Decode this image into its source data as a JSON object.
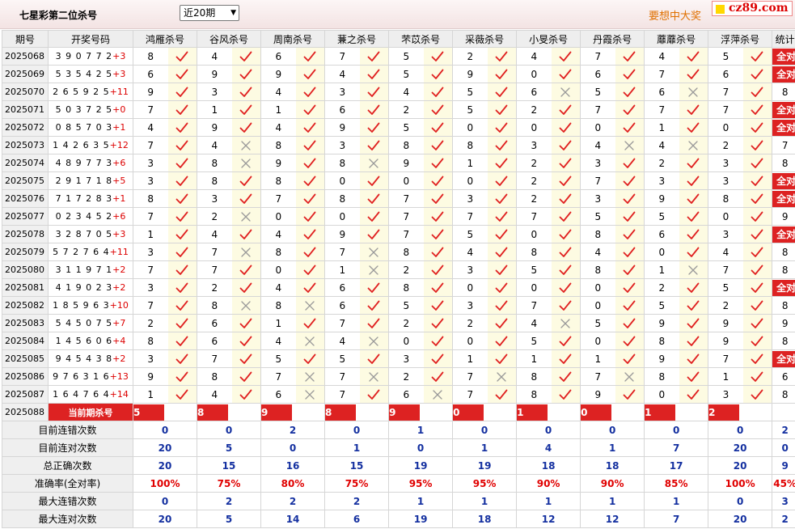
{
  "header": {
    "title": "七星彩第二位杀号",
    "period_select": "近20期",
    "ad_text": "要想中大奖",
    "logo_text": "cz89.com"
  },
  "columns": [
    "期号",
    "开奖号码",
    "鸿雁杀号",
    "谷风杀号",
    "周南杀号",
    "蒹之杀号",
    "芣苡杀号",
    "采薇杀号",
    "小旻杀号",
    "丹霞杀号",
    "蘼蘼杀号",
    "浮萍杀号",
    "统计"
  ],
  "rows": [
    {
      "issue": "2025068",
      "num": "390772",
      "sum": "+3",
      "k": [
        [
          "8",
          1
        ],
        [
          "4",
          1
        ],
        [
          "6",
          1
        ],
        [
          "7",
          1
        ],
        [
          "5",
          1
        ],
        [
          "2",
          1
        ],
        [
          "4",
          1
        ],
        [
          "7",
          1
        ],
        [
          "4",
          1
        ],
        [
          "5",
          1
        ]
      ],
      "stat": "全对"
    },
    {
      "issue": "2025069",
      "num": "535425",
      "sum": "+3",
      "k": [
        [
          "6",
          1
        ],
        [
          "9",
          1
        ],
        [
          "9",
          1
        ],
        [
          "4",
          1
        ],
        [
          "5",
          1
        ],
        [
          "9",
          1
        ],
        [
          "0",
          1
        ],
        [
          "6",
          1
        ],
        [
          "7",
          1
        ],
        [
          "6",
          1
        ]
      ],
      "stat": "全对"
    },
    {
      "issue": "2025070",
      "num": "265925",
      "sum": "+11",
      "k": [
        [
          "9",
          1
        ],
        [
          "3",
          1
        ],
        [
          "4",
          1
        ],
        [
          "3",
          1
        ],
        [
          "4",
          1
        ],
        [
          "5",
          1
        ],
        [
          "6",
          0
        ],
        [
          "5",
          1
        ],
        [
          "6",
          0
        ],
        [
          "7",
          1
        ]
      ],
      "stat": "8"
    },
    {
      "issue": "2025071",
      "num": "503725",
      "sum": "+0",
      "k": [
        [
          "7",
          1
        ],
        [
          "1",
          1
        ],
        [
          "1",
          1
        ],
        [
          "6",
          1
        ],
        [
          "2",
          1
        ],
        [
          "5",
          1
        ],
        [
          "2",
          1
        ],
        [
          "7",
          1
        ],
        [
          "7",
          1
        ],
        [
          "7",
          1
        ]
      ],
      "stat": "全对"
    },
    {
      "issue": "2025072",
      "num": "085703",
      "sum": "+1",
      "k": [
        [
          "4",
          1
        ],
        [
          "9",
          1
        ],
        [
          "4",
          1
        ],
        [
          "9",
          1
        ],
        [
          "5",
          1
        ],
        [
          "0",
          1
        ],
        [
          "0",
          1
        ],
        [
          "0",
          1
        ],
        [
          "1",
          1
        ],
        [
          "0",
          1
        ]
      ],
      "stat": "全对"
    },
    {
      "issue": "2025073",
      "num": "142635",
      "sum": "+12",
      "k": [
        [
          "7",
          1
        ],
        [
          "4",
          0
        ],
        [
          "8",
          1
        ],
        [
          "3",
          1
        ],
        [
          "8",
          1
        ],
        [
          "8",
          1
        ],
        [
          "3",
          1
        ],
        [
          "4",
          0
        ],
        [
          "4",
          0
        ],
        [
          "2",
          1
        ]
      ],
      "stat": "7"
    },
    {
      "issue": "2025074",
      "num": "489773",
      "sum": "+6",
      "k": [
        [
          "3",
          1
        ],
        [
          "8",
          0
        ],
        [
          "9",
          1
        ],
        [
          "8",
          0
        ],
        [
          "9",
          1
        ],
        [
          "1",
          1
        ],
        [
          "2",
          1
        ],
        [
          "3",
          1
        ],
        [
          "2",
          1
        ],
        [
          "3",
          1
        ]
      ],
      "stat": "8"
    },
    {
      "issue": "2025075",
      "num": "291718",
      "sum": "+5",
      "k": [
        [
          "3",
          1
        ],
        [
          "8",
          1
        ],
        [
          "8",
          1
        ],
        [
          "0",
          1
        ],
        [
          "0",
          1
        ],
        [
          "0",
          1
        ],
        [
          "2",
          1
        ],
        [
          "7",
          1
        ],
        [
          "3",
          1
        ],
        [
          "3",
          1
        ]
      ],
      "stat": "全对"
    },
    {
      "issue": "2025076",
      "num": "717283",
      "sum": "+1",
      "k": [
        [
          "8",
          1
        ],
        [
          "3",
          1
        ],
        [
          "7",
          1
        ],
        [
          "8",
          1
        ],
        [
          "7",
          1
        ],
        [
          "3",
          1
        ],
        [
          "2",
          1
        ],
        [
          "3",
          1
        ],
        [
          "9",
          1
        ],
        [
          "8",
          1
        ]
      ],
      "stat": "全对"
    },
    {
      "issue": "2025077",
      "num": "023452",
      "sum": "+6",
      "k": [
        [
          "7",
          1
        ],
        [
          "2",
          0
        ],
        [
          "0",
          1
        ],
        [
          "0",
          1
        ],
        [
          "7",
          1
        ],
        [
          "7",
          1
        ],
        [
          "7",
          1
        ],
        [
          "5",
          1
        ],
        [
          "5",
          1
        ],
        [
          "0",
          1
        ]
      ],
      "stat": "9"
    },
    {
      "issue": "2025078",
      "num": "328705",
      "sum": "+3",
      "k": [
        [
          "1",
          1
        ],
        [
          "4",
          1
        ],
        [
          "4",
          1
        ],
        [
          "9",
          1
        ],
        [
          "7",
          1
        ],
        [
          "5",
          1
        ],
        [
          "0",
          1
        ],
        [
          "8",
          1
        ],
        [
          "6",
          1
        ],
        [
          "3",
          1
        ]
      ],
      "stat": "全对"
    },
    {
      "issue": "2025079",
      "num": "572764",
      "sum": "+11",
      "k": [
        [
          "3",
          1
        ],
        [
          "7",
          0
        ],
        [
          "8",
          1
        ],
        [
          "7",
          0
        ],
        [
          "8",
          1
        ],
        [
          "4",
          1
        ],
        [
          "8",
          1
        ],
        [
          "4",
          1
        ],
        [
          "0",
          1
        ],
        [
          "4",
          1
        ]
      ],
      "stat": "8"
    },
    {
      "issue": "2025080",
      "num": "311971",
      "sum": "+2",
      "k": [
        [
          "7",
          1
        ],
        [
          "7",
          1
        ],
        [
          "0",
          1
        ],
        [
          "1",
          0
        ],
        [
          "2",
          1
        ],
        [
          "3",
          1
        ],
        [
          "5",
          1
        ],
        [
          "8",
          1
        ],
        [
          "1",
          0
        ],
        [
          "7",
          1
        ]
      ],
      "stat": "8"
    },
    {
      "issue": "2025081",
      "num": "419023",
      "sum": "+2",
      "k": [
        [
          "3",
          1
        ],
        [
          "2",
          1
        ],
        [
          "4",
          1
        ],
        [
          "6",
          1
        ],
        [
          "8",
          1
        ],
        [
          "0",
          1
        ],
        [
          "0",
          1
        ],
        [
          "0",
          1
        ],
        [
          "2",
          1
        ],
        [
          "5",
          1
        ]
      ],
      "stat": "全对"
    },
    {
      "issue": "2025082",
      "num": "185963",
      "sum": "+10",
      "k": [
        [
          "7",
          1
        ],
        [
          "8",
          0
        ],
        [
          "8",
          0
        ],
        [
          "6",
          1
        ],
        [
          "5",
          1
        ],
        [
          "3",
          1
        ],
        [
          "7",
          1
        ],
        [
          "0",
          1
        ],
        [
          "5",
          1
        ],
        [
          "2",
          1
        ]
      ],
      "stat": "8"
    },
    {
      "issue": "2025083",
      "num": "545075",
      "sum": "+7",
      "k": [
        [
          "2",
          1
        ],
        [
          "6",
          1
        ],
        [
          "1",
          1
        ],
        [
          "7",
          1
        ],
        [
          "2",
          1
        ],
        [
          "2",
          1
        ],
        [
          "4",
          0
        ],
        [
          "5",
          1
        ],
        [
          "9",
          1
        ],
        [
          "9",
          1
        ]
      ],
      "stat": "9"
    },
    {
      "issue": "2025084",
      "num": "145606",
      "sum": "+4",
      "k": [
        [
          "8",
          1
        ],
        [
          "6",
          1
        ],
        [
          "4",
          0
        ],
        [
          "4",
          0
        ],
        [
          "0",
          1
        ],
        [
          "0",
          1
        ],
        [
          "5",
          1
        ],
        [
          "0",
          1
        ],
        [
          "8",
          1
        ],
        [
          "9",
          1
        ]
      ],
      "stat": "8"
    },
    {
      "issue": "2025085",
      "num": "945438",
      "sum": "+2",
      "k": [
        [
          "3",
          1
        ],
        [
          "7",
          1
        ],
        [
          "5",
          1
        ],
        [
          "5",
          1
        ],
        [
          "3",
          1
        ],
        [
          "1",
          1
        ],
        [
          "1",
          1
        ],
        [
          "1",
          1
        ],
        [
          "9",
          1
        ],
        [
          "7",
          1
        ]
      ],
      "stat": "全对"
    },
    {
      "issue": "2025086",
      "num": "976316",
      "sum": "+13",
      "k": [
        [
          "9",
          1
        ],
        [
          "8",
          1
        ],
        [
          "7",
          0
        ],
        [
          "7",
          0
        ],
        [
          "2",
          1
        ],
        [
          "7",
          0
        ],
        [
          "8",
          1
        ],
        [
          "7",
          0
        ],
        [
          "8",
          1
        ],
        [
          "1",
          1
        ]
      ],
      "stat": "6"
    },
    {
      "issue": "2025087",
      "num": "164764",
      "sum": "+14",
      "k": [
        [
          "1",
          1
        ],
        [
          "4",
          1
        ],
        [
          "6",
          0
        ],
        [
          "7",
          1
        ],
        [
          "6",
          0
        ],
        [
          "7",
          1
        ],
        [
          "8",
          1
        ],
        [
          "9",
          1
        ],
        [
          "0",
          1
        ],
        [
          "3",
          1
        ]
      ],
      "stat": "8"
    }
  ],
  "current": {
    "issue": "2025088",
    "label": "当前期杀号",
    "values": [
      "5",
      "8",
      "9",
      "8",
      "9",
      "0",
      "1",
      "0",
      "1",
      "2"
    ]
  },
  "stats": [
    {
      "label": "目前连错次数",
      "type": "blue",
      "values": [
        "0",
        "0",
        "2",
        "0",
        "1",
        "0",
        "0",
        "0",
        "0",
        "0",
        "2"
      ]
    },
    {
      "label": "目前连对次数",
      "type": "blue",
      "values": [
        "20",
        "5",
        "0",
        "1",
        "0",
        "1",
        "4",
        "1",
        "7",
        "20",
        "0"
      ]
    },
    {
      "label": "总正确次数",
      "type": "blue",
      "values": [
        "20",
        "15",
        "16",
        "15",
        "19",
        "19",
        "18",
        "18",
        "17",
        "20",
        "9"
      ]
    },
    {
      "label": "准确率(全对率)",
      "type": "pct",
      "values": [
        "100%",
        "75%",
        "80%",
        "75%",
        "95%",
        "95%",
        "90%",
        "90%",
        "85%",
        "100%",
        "45%"
      ]
    },
    {
      "label": "最大连错次数",
      "type": "blue",
      "values": [
        "0",
        "2",
        "2",
        "2",
        "1",
        "1",
        "1",
        "1",
        "1",
        "0",
        "3"
      ]
    },
    {
      "label": "最大连对次数",
      "type": "blue",
      "values": [
        "20",
        "5",
        "14",
        "6",
        "19",
        "18",
        "12",
        "12",
        "7",
        "20",
        "2"
      ]
    }
  ],
  "colors": {
    "correct": "#e02020",
    "wrong": "#999999",
    "badge": "#d22222",
    "stat_blue": "#1430a0",
    "pct_red": "#e00000"
  }
}
